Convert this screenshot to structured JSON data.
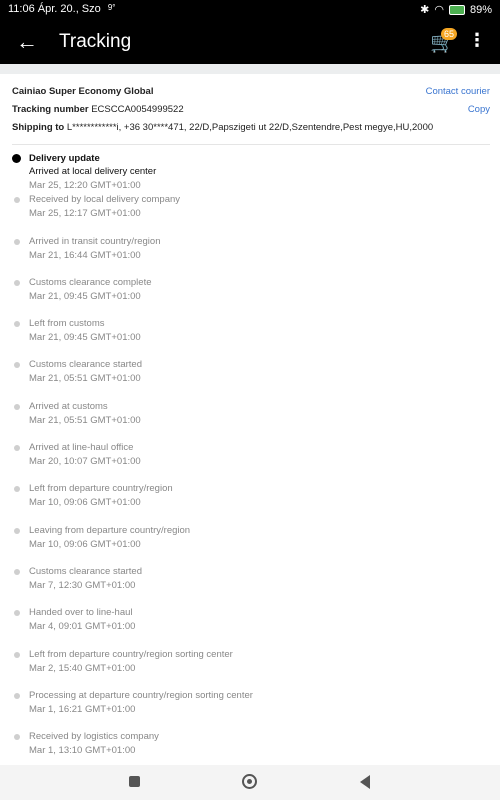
{
  "status_bar": {
    "time": "11:06",
    "date": "Ápr. 20., Szo",
    "temperature": "9°",
    "battery": "89%",
    "icons": [
      "bluetooth-icon",
      "wifi-icon",
      "battery-icon"
    ]
  },
  "app_bar": {
    "title": "Tracking",
    "cart_badge": "65",
    "icons": [
      "back-arrow-icon",
      "cart-icon",
      "more-vert-icon"
    ]
  },
  "shipment": {
    "carrier": "Cainiao Super Economy Global",
    "contact_label": "Contact courier",
    "tracking_label": "Tracking number",
    "tracking_number": "ECSCCA0054999522",
    "copy_label": "Copy",
    "shipping_label": "Shipping to",
    "shipping_address": "L************i, +36 30****471, 22/D,Papszigeti ut 22/D,Szentendre,Pest megye,HU,2000"
  },
  "timeline": {
    "current_header": "Delivery update",
    "events": [
      {
        "status": "Arrived at local delivery center",
        "time": "Mar 25, 12:20 GMT+01:00"
      },
      {
        "status": "Received by local delivery company",
        "time": "Mar 25, 12:17 GMT+01:00"
      },
      {
        "status": "Arrived in transit country/region",
        "time": "Mar 21, 16:44 GMT+01:00"
      },
      {
        "status": "Customs clearance complete",
        "time": "Mar 21, 09:45 GMT+01:00"
      },
      {
        "status": "Left from customs",
        "time": "Mar 21, 09:45 GMT+01:00"
      },
      {
        "status": "Customs clearance started",
        "time": "Mar 21, 05:51 GMT+01:00"
      },
      {
        "status": "Arrived at customs",
        "time": "Mar 21, 05:51 GMT+01:00"
      },
      {
        "status": "Arrived at line-haul office",
        "time": "Mar 20, 10:07 GMT+01:00"
      },
      {
        "status": "Left from departure country/region",
        "time": "Mar 10, 09:06 GMT+01:00"
      },
      {
        "status": "Leaving from departure country/region",
        "time": "Mar 10, 09:06 GMT+01:00"
      },
      {
        "status": "Customs clearance started",
        "time": "Mar 7, 12:30 GMT+01:00"
      },
      {
        "status": "Handed over to line-haul",
        "time": "Mar 4, 09:01 GMT+01:00"
      },
      {
        "status": "Left from departure country/region sorting center",
        "time": "Mar 2, 15:40 GMT+01:00"
      },
      {
        "status": "Processing at departure country/region sorting center",
        "time": "Mar 1, 16:21 GMT+01:00"
      },
      {
        "status": "Received by logistics company",
        "time": "Mar 1, 13:10 GMT+01:00"
      }
    ]
  },
  "nav_bar": {
    "icons": [
      "recent-apps-icon",
      "home-icon",
      "back-icon"
    ]
  },
  "colors": {
    "app_bar": "#000000",
    "link": "#3a75d0",
    "cart_badge": "#f5a623",
    "muted_text": "#888888",
    "timeline_dot_current": "#000000",
    "timeline_dot": "#cfcfcf"
  }
}
